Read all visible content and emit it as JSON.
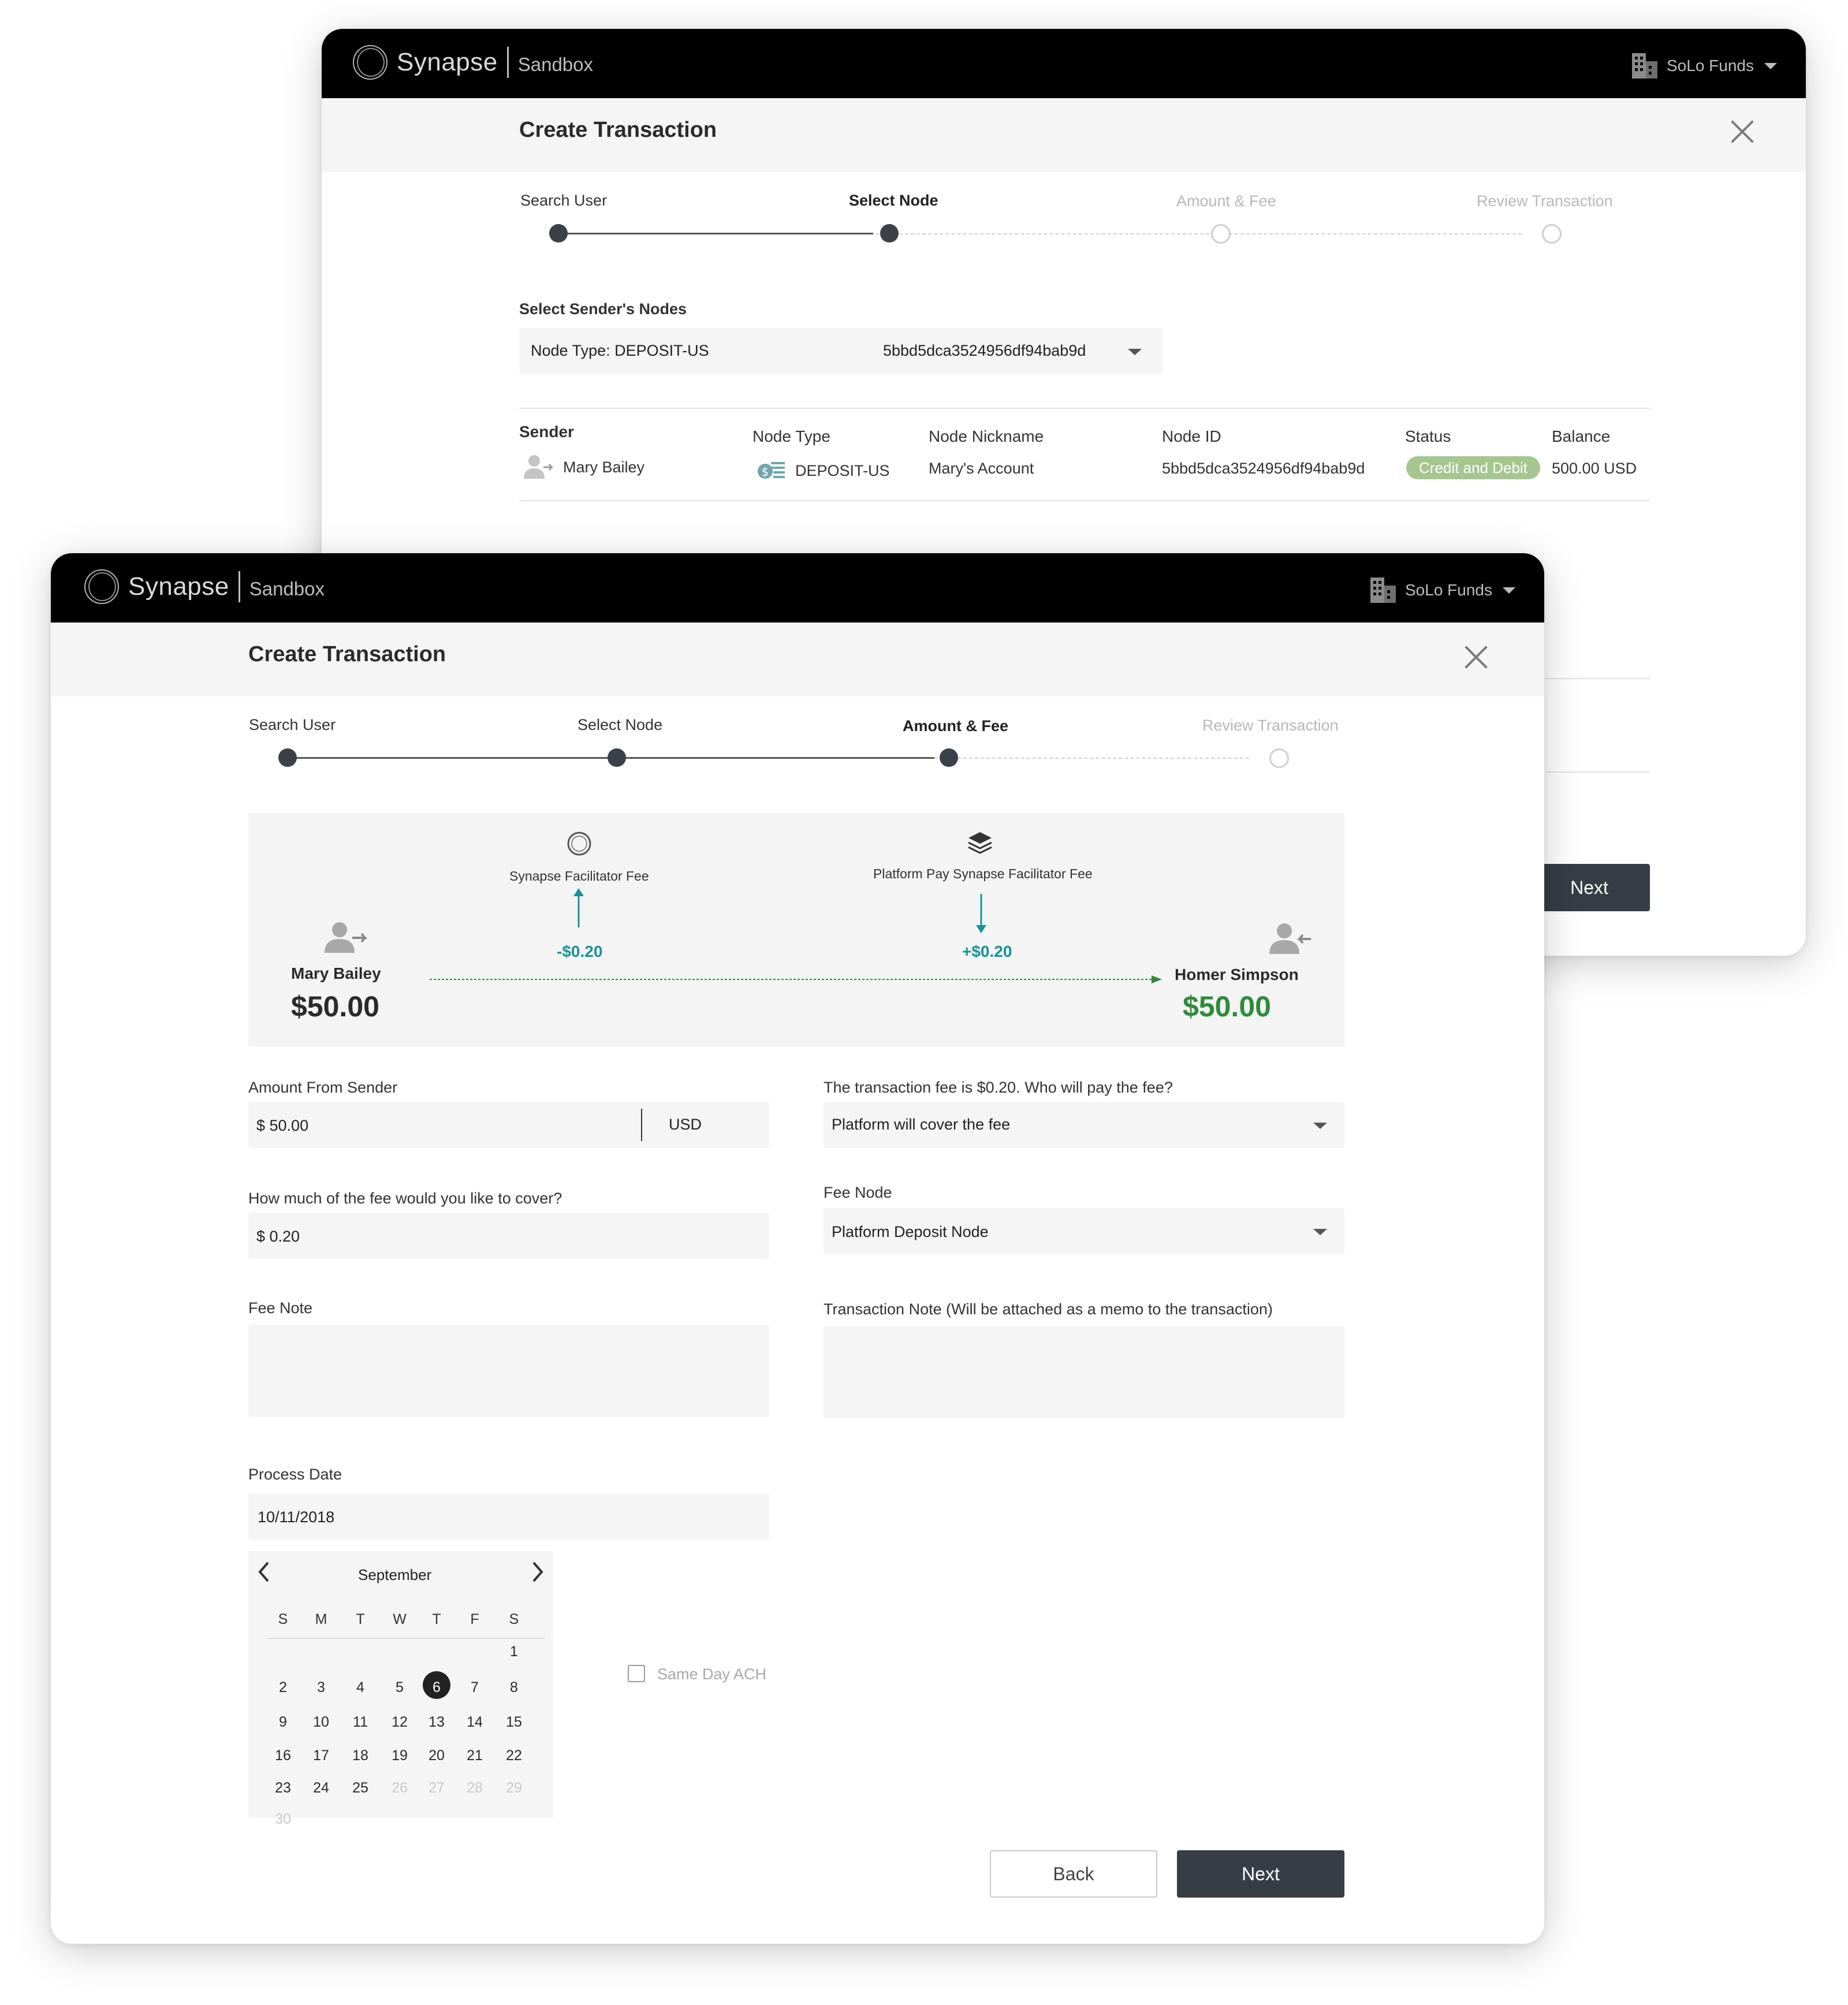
{
  "app": {
    "brand": "Synapse",
    "environment": "Sandbox",
    "org_name": "SoLo Funds"
  },
  "colors": {
    "topbar": "#000000",
    "accent_teal": "#17939a",
    "money_green": "#2e8b3a",
    "status_green": "#a5c78f",
    "button_dark": "#363d45"
  },
  "back_window": {
    "title": "Create Transaction",
    "steps": [
      {
        "label": "Search User",
        "state": "done"
      },
      {
        "label": "Select Node",
        "state": "current"
      },
      {
        "label": "Amount & Fee",
        "state": "future"
      },
      {
        "label": "Review Transaction",
        "state": "future"
      }
    ],
    "sender_nodes_label": "Select Sender's Nodes",
    "node_select": {
      "type": "Node Type: DEPOSIT-US",
      "id": "5bbd5dca3524956df94bab9d"
    },
    "table": {
      "headers": {
        "sender": "Sender",
        "node_type": "Node Type",
        "nickname": "Node Nickname",
        "node_id": "Node ID",
        "status": "Status",
        "balance": "Balance"
      },
      "row": {
        "sender": "Mary Bailey",
        "node_type": "DEPOSIT-US",
        "nickname": "Mary's Account",
        "node_id": "5bbd5dca3524956df94bab9d",
        "status": "Credit and Debit",
        "balance": "500.00 USD"
      }
    },
    "next_label": "Next"
  },
  "front_window": {
    "title": "Create Transaction",
    "steps": [
      {
        "label": "Search User",
        "state": "done"
      },
      {
        "label": "Select Node",
        "state": "done"
      },
      {
        "label": "Amount & Fee",
        "state": "current"
      },
      {
        "label": "Review Transaction",
        "state": "future"
      }
    ],
    "flow": {
      "sender_name": "Mary Bailey",
      "sender_amount": "$50.00",
      "receiver_name": "Homer Simpson",
      "receiver_amount": "$50.00",
      "facilitator_fee_label": "Synapse Facilitator Fee",
      "facilitator_fee_amount": "-$0.20",
      "platform_fee_label": "Platform Pay Synapse Facilitator Fee",
      "platform_fee_amount": "+$0.20"
    },
    "form": {
      "amount_label": "Amount From Sender",
      "amount_value": "$ 50.00",
      "currency": "USD",
      "fee_payer_label": "The transaction fee is $0.20. Who will pay the fee?",
      "fee_payer_value": "Platform will cover the fee",
      "fee_cover_label": "How much of the fee would you like to cover?",
      "fee_cover_value": "$ 0.20",
      "fee_node_label": "Fee Node",
      "fee_node_value": "Platform Deposit Node",
      "fee_note_label": "Fee Note",
      "fee_note_value": "",
      "tx_note_label": "Transaction Note (Will be attached as a memo to the transaction)",
      "tx_note_value": "",
      "process_date_label": "Process Date",
      "process_date_value": "10/11/2018",
      "same_day_ach_label": "Same Day ACH",
      "same_day_ach_checked": false
    },
    "calendar": {
      "month": "September",
      "weekdays": [
        "S",
        "M",
        "T",
        "W",
        "T",
        "F",
        "S"
      ],
      "weeks": [
        [
          "",
          "",
          "",
          "",
          "",
          "",
          "1"
        ],
        [
          "2",
          "3",
          "4",
          "5",
          "6",
          "7",
          "8"
        ],
        [
          "9",
          "10",
          "11",
          "12",
          "13",
          "14",
          "15"
        ],
        [
          "16",
          "17",
          "18",
          "19",
          "20",
          "21",
          "22"
        ],
        [
          "23",
          "24",
          "25",
          "26",
          "27",
          "28",
          "29"
        ],
        [
          "30",
          "",
          "",
          "",
          "",
          "",
          ""
        ]
      ],
      "selected": "6",
      "disabled_from": "26"
    },
    "back_label": "Back",
    "next_label": "Next"
  }
}
